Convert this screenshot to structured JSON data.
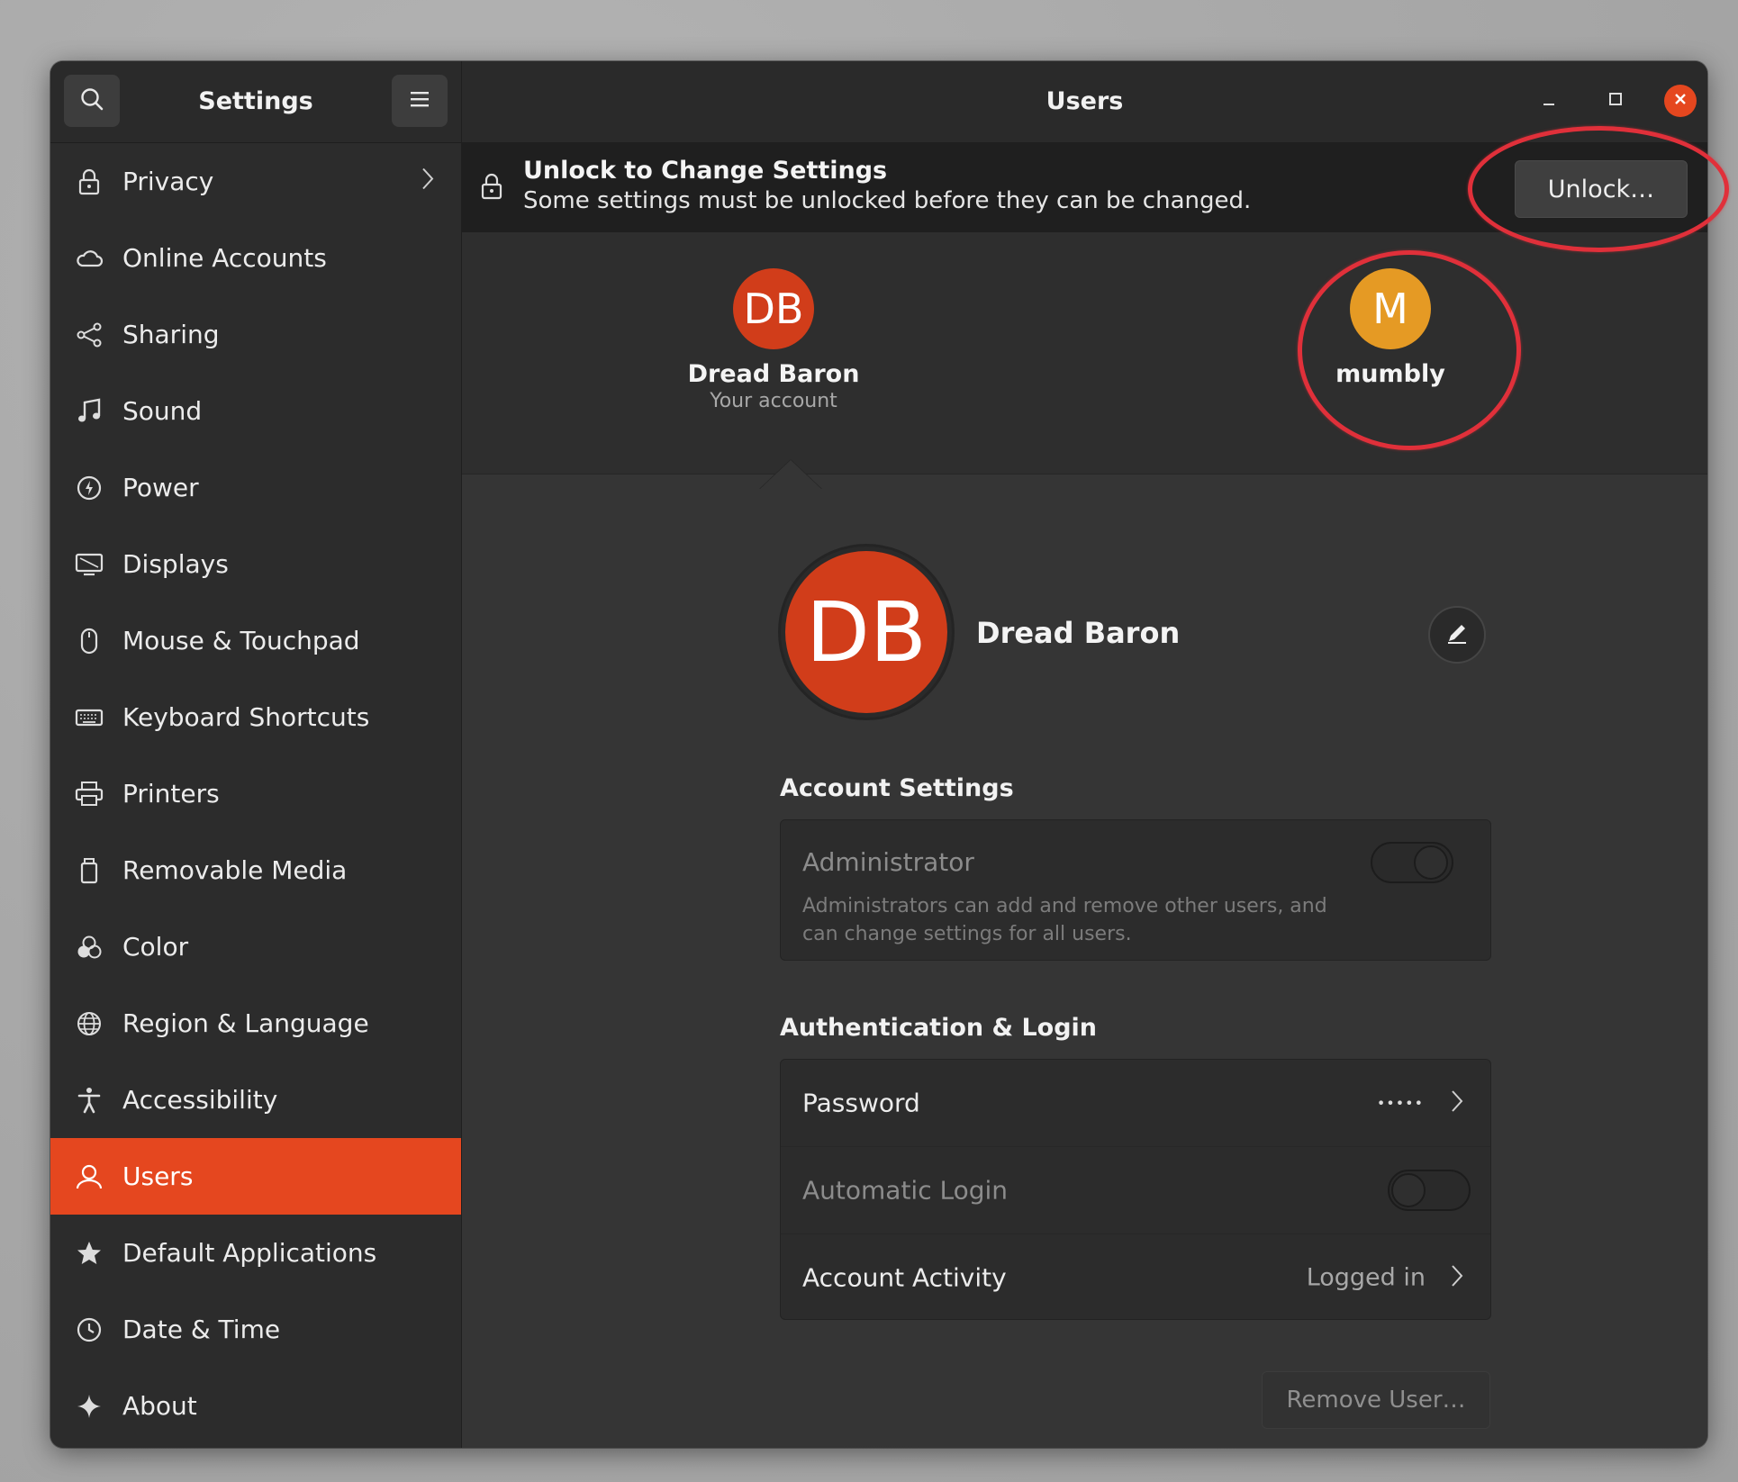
{
  "sidebar": {
    "title": "Settings",
    "items": [
      {
        "label": "Privacy",
        "icon": "lock-icon",
        "has_chevron": true
      },
      {
        "label": "Online Accounts",
        "icon": "cloud-icon"
      },
      {
        "label": "Sharing",
        "icon": "share-icon"
      },
      {
        "label": "Sound",
        "icon": "music-note-icon"
      },
      {
        "label": "Power",
        "icon": "power-icon"
      },
      {
        "label": "Displays",
        "icon": "display-icon"
      },
      {
        "label": "Mouse & Touchpad",
        "icon": "mouse-icon"
      },
      {
        "label": "Keyboard Shortcuts",
        "icon": "keyboard-icon"
      },
      {
        "label": "Printers",
        "icon": "printer-icon"
      },
      {
        "label": "Removable Media",
        "icon": "removable-media-icon"
      },
      {
        "label": "Color",
        "icon": "color-icon"
      },
      {
        "label": "Region & Language",
        "icon": "globe-icon"
      },
      {
        "label": "Accessibility",
        "icon": "accessibility-icon"
      },
      {
        "label": "Users",
        "icon": "user-icon",
        "active": true
      },
      {
        "label": "Default Applications",
        "icon": "star-icon"
      },
      {
        "label": "Date & Time",
        "icon": "clock-icon"
      },
      {
        "label": "About",
        "icon": "sparkle-icon"
      }
    ]
  },
  "header": {
    "title": "Users"
  },
  "infobar": {
    "title": "Unlock to Change Settings",
    "subtitle": "Some settings must be unlocked before they can be changed.",
    "unlock_label": "Unlock…"
  },
  "users": [
    {
      "initials": "DB",
      "name": "Dread Baron",
      "subtitle": "Your account",
      "color": "#d13d1a"
    },
    {
      "initials": "M",
      "name": "mumbly",
      "subtitle": "",
      "color": "#e59a24"
    }
  ],
  "profile": {
    "initials": "DB",
    "name": "Dread Baron"
  },
  "account_settings": {
    "title": "Account Settings",
    "admin_label": "Administrator",
    "admin_desc_line1": "Administrators can add and remove other users, and",
    "admin_desc_line2": "can change settings for all users."
  },
  "auth": {
    "title": "Authentication & Login",
    "password_label": "Password",
    "password_value": "•••••",
    "autologin_label": "Automatic Login",
    "activity_label": "Account Activity",
    "activity_value": "Logged in"
  },
  "remove_label": "Remove User…",
  "colors": {
    "accent": "#e5471f",
    "annotation": "#e0303a"
  }
}
